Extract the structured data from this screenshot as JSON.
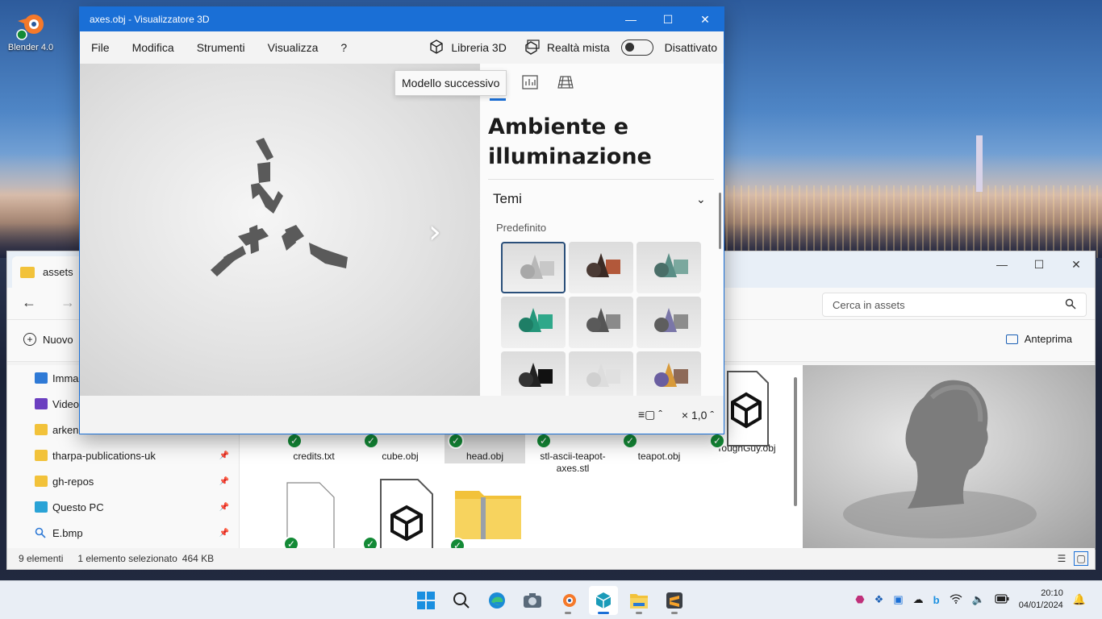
{
  "desktop": {
    "icon_label": "Blender 4.0"
  },
  "explorer": {
    "tab_title": "assets",
    "search_placeholder": "Cerca in assets",
    "new_label": "Nuovo",
    "preview_label": "Anteprima",
    "sidebar": [
      {
        "label": "Immagini",
        "pinned": false
      },
      {
        "label": "Video",
        "pinned": false
      },
      {
        "label": "arkenio",
        "pinned": false
      },
      {
        "label": "tharpa-publications-uk",
        "pinned": true
      },
      {
        "label": "gh-repos",
        "pinned": true
      },
      {
        "label": "Questo PC",
        "pinned": true
      },
      {
        "label": "E.bmp",
        "pinned": true
      }
    ],
    "files": [
      {
        "name": "credits.txt"
      },
      {
        "name": "cube.obj"
      },
      {
        "name": "head.obj",
        "selected": true
      },
      {
        "name": "stl-ascii-teapot-axes.stl"
      },
      {
        "name": "teapot.obj"
      },
      {
        "name": "ToughGuy.obj"
      }
    ],
    "status_count": "9 elementi",
    "status_selected": "1 elemento selezionato",
    "status_size": "464 KB"
  },
  "viewer": {
    "title": "axes.obj - Visualizzatore 3D",
    "menu": [
      "File",
      "Modifica",
      "Strumenti",
      "Visualizza",
      "?"
    ],
    "library_label": "Libreria 3D",
    "mixed_reality_label": "Realtà mista",
    "toggle_state_label": "Disattivato",
    "tooltip": "Modello successivo",
    "panel_title": "Ambiente e illuminazione",
    "section_title": "Temi",
    "section_sub": "Predefinito",
    "zoom_label": "× 1,0",
    "accent": "#1a6fd6"
  },
  "taskbar": {
    "time": "20:10",
    "date": "04/01/2024"
  }
}
